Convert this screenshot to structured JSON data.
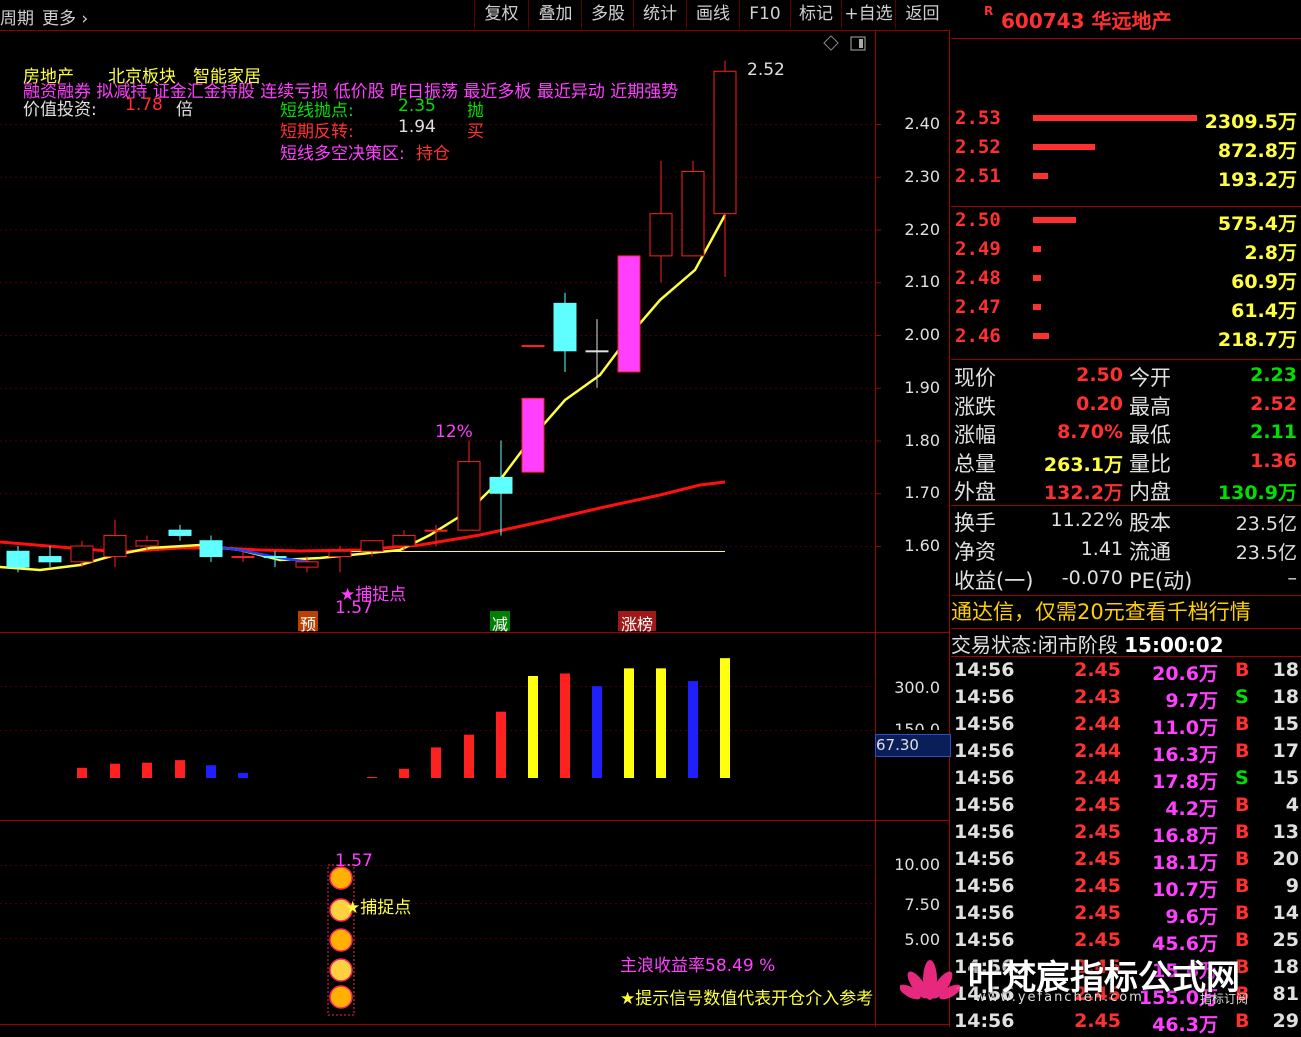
{
  "toolbar": {
    "period": "周期",
    "more": "更多",
    "buttons": [
      "复权",
      "叠加",
      "多股",
      "统计",
      "画线",
      "F10",
      "标记",
      "+自选",
      "返回"
    ]
  },
  "stock": {
    "mark": "R",
    "code_name": "600743 华远地产"
  },
  "main_chart": {
    "tags": [
      "房地产",
      "北京板块",
      "智能家居"
    ],
    "concepts": "融资融券 拟减持 证金汇金持股 连续亏损 低价股 昨日振荡 最近多板 最近异动 近期强势",
    "value_label": "价值投资:",
    "value_num": "1.78",
    "value_unit": "倍",
    "short_sell_label": "短线抛点:",
    "short_sell_val": "2.35",
    "short_sell_action": "抛",
    "short_rev_label": "短期反转:",
    "short_rev_val": "1.94",
    "short_rev_action": "买",
    "zone_label": "短线多空决策区:",
    "zone_val": "持仓",
    "high_label": "2.52",
    "pct_label": "12%",
    "catch_label": "★捕捉点",
    "catch_val": "1.57",
    "markers": [
      "预",
      "减",
      "涨榜"
    ],
    "y_axis": [
      "2.40",
      "2.30",
      "2.20",
      "2.10",
      "2.00",
      "1.90",
      "1.80",
      "1.70",
      "1.60"
    ]
  },
  "chart_data": {
    "type": "candlestick",
    "y_range": [
      1.53,
      2.55
    ],
    "candles": [
      {
        "o": 1.56,
        "h": 1.6,
        "l": 1.55,
        "c": 1.59,
        "col": "cyan"
      },
      {
        "o": 1.58,
        "h": 1.6,
        "l": 1.56,
        "c": 1.57,
        "col": "cyan"
      },
      {
        "o": 1.57,
        "h": 1.61,
        "l": 1.56,
        "c": 1.6,
        "col": "red"
      },
      {
        "o": 1.58,
        "h": 1.65,
        "l": 1.56,
        "c": 1.62,
        "col": "red"
      },
      {
        "o": 1.6,
        "h": 1.62,
        "l": 1.59,
        "c": 1.61,
        "col": "red"
      },
      {
        "o": 1.62,
        "h": 1.64,
        "l": 1.61,
        "c": 1.63,
        "col": "cyan"
      },
      {
        "o": 1.61,
        "h": 1.62,
        "l": 1.57,
        "c": 1.58,
        "col": "cyan"
      },
      {
        "o": 1.58,
        "h": 1.59,
        "l": 1.57,
        "c": 1.58,
        "col": "red"
      },
      {
        "o": 1.58,
        "h": 1.59,
        "l": 1.56,
        "c": 1.58,
        "col": "cyan"
      },
      {
        "o": 1.56,
        "h": 1.58,
        "l": 1.55,
        "c": 1.57,
        "col": "red"
      },
      {
        "o": 1.58,
        "h": 1.6,
        "l": 1.55,
        "c": 1.59,
        "col": "red"
      },
      {
        "o": 1.59,
        "h": 1.61,
        "l": 1.58,
        "c": 1.61,
        "col": "red"
      },
      {
        "o": 1.6,
        "h": 1.63,
        "l": 1.59,
        "c": 1.62,
        "col": "red"
      },
      {
        "o": 1.63,
        "h": 1.64,
        "l": 1.6,
        "c": 1.63,
        "col": "red"
      },
      {
        "o": 1.63,
        "h": 1.8,
        "l": 1.63,
        "c": 1.76,
        "col": "red"
      },
      {
        "o": 1.73,
        "h": 1.8,
        "l": 1.62,
        "c": 1.7,
        "col": "cyan"
      },
      {
        "o": 1.74,
        "h": 1.88,
        "l": 1.74,
        "c": 1.88,
        "col": "magenta"
      },
      {
        "o": 1.98,
        "h": 1.98,
        "l": 1.98,
        "c": 1.98,
        "col": "magenta"
      },
      {
        "o": 2.06,
        "h": 2.08,
        "l": 1.93,
        "c": 1.97,
        "col": "cyan"
      },
      {
        "o": 1.97,
        "h": 2.03,
        "l": 1.9,
        "c": 1.97,
        "col": "white"
      },
      {
        "o": 1.93,
        "h": 2.15,
        "l": 1.93,
        "c": 2.15,
        "col": "magenta"
      },
      {
        "o": 2.15,
        "h": 2.33,
        "l": 2.1,
        "c": 2.23,
        "col": "red"
      },
      {
        "o": 2.15,
        "h": 2.33,
        "l": 2.15,
        "c": 2.31,
        "col": "red"
      },
      {
        "o": 2.23,
        "h": 2.52,
        "l": 2.11,
        "c": 2.5,
        "col": "red"
      }
    ]
  },
  "vol_panel": {
    "y_axis": [
      "300.0",
      "150.0"
    ],
    "cursor_val": "67.30",
    "bars": [
      {
        "v": 20,
        "c": "red"
      },
      {
        "v": 28,
        "c": "red"
      },
      {
        "v": 30,
        "c": "red"
      },
      {
        "v": 35,
        "c": "red"
      },
      {
        "v": 25,
        "c": "blue"
      },
      {
        "v": 10,
        "c": "blue"
      },
      {
        "v": 0,
        "c": "red"
      },
      {
        "v": 0,
        "c": "red"
      },
      {
        "v": 0,
        "c": "red"
      },
      {
        "v": 2,
        "c": "red"
      },
      {
        "v": 18,
        "c": "red"
      },
      {
        "v": 60,
        "c": "red"
      },
      {
        "v": 85,
        "c": "red"
      },
      {
        "v": 130,
        "c": "red"
      },
      {
        "v": 200,
        "c": "yellow"
      },
      {
        "v": 205,
        "c": "red"
      },
      {
        "v": 180,
        "c": "blue"
      },
      {
        "v": 215,
        "c": "yellow"
      },
      {
        "v": 215,
        "c": "yellow"
      },
      {
        "v": 190,
        "c": "blue"
      },
      {
        "v": 235,
        "c": "yellow"
      }
    ]
  },
  "sub_panel": {
    "y_axis": [
      "10.00",
      "7.50",
      "5.00"
    ],
    "top_val": "1.57",
    "catch_label": "★捕捉点",
    "yield_label": "主浪收益率",
    "yield_val": "58.49 %",
    "hint": "★提示信号数值代表开仓介入参考"
  },
  "order_book": {
    "asks": [
      {
        "p": "2.53",
        "v": "2309.5万",
        "w": 100
      },
      {
        "p": "2.52",
        "v": "872.8万",
        "w": 38
      },
      {
        "p": "2.51",
        "v": "193.2万",
        "w": 9
      }
    ],
    "bids": [
      {
        "p": "2.50",
        "v": "575.4万",
        "w": 26
      },
      {
        "p": "2.49",
        "v": "2.8万",
        "w": 1
      },
      {
        "p": "2.48",
        "v": "60.9万",
        "w": 2
      },
      {
        "p": "2.47",
        "v": "61.4万",
        "w": 2
      },
      {
        "p": "2.46",
        "v": "218.7万",
        "w": 10
      }
    ]
  },
  "quote": {
    "rows": [
      {
        "l1": "现价",
        "v1": "2.50",
        "c1": "#ff3030",
        "l2": "今开",
        "v2": "2.23",
        "c2": "#00e000"
      },
      {
        "l1": "涨跌",
        "v1": "0.20",
        "c1": "#ff3030",
        "l2": "最高",
        "v2": "2.52",
        "c2": "#ff3030"
      },
      {
        "l1": "涨幅",
        "v1": "8.70%",
        "c1": "#ff3030",
        "l2": "最低",
        "v2": "2.11",
        "c2": "#00e000"
      },
      {
        "l1": "总量",
        "v1": "263.1万",
        "c1": "#ffff40",
        "l2": "量比",
        "v2": "1.36",
        "c2": "#ff3030"
      },
      {
        "l1": "外盘",
        "v1": "132.2万",
        "c1": "#ff3030",
        "l2": "内盘",
        "v2": "130.9万",
        "c2": "#00e000"
      }
    ],
    "rows2": [
      {
        "l1": "换手",
        "v1": "11.22%",
        "l2": "股本",
        "v2": "23.5亿"
      },
      {
        "l1": "净资",
        "v1": "1.41",
        "l2": "流通",
        "v2": "23.5亿"
      },
      {
        "l1": "收益(一)",
        "v1": "-0.070",
        "l2": "PE(动)",
        "v2": "–"
      }
    ]
  },
  "banner": "通达信，仅需20元查看千档行情",
  "trade_status": {
    "label": "交易状态:",
    "state": "闭市阶段",
    "time": "15:00:02"
  },
  "ticks": [
    {
      "t": "14:56",
      "p": "2.45",
      "v": "20.6万",
      "s": "B",
      "n": "18"
    },
    {
      "t": "14:56",
      "p": "2.43",
      "v": "9.7万",
      "s": "S",
      "n": "18"
    },
    {
      "t": "14:56",
      "p": "2.44",
      "v": "11.0万",
      "s": "B",
      "n": "15"
    },
    {
      "t": "14:56",
      "p": "2.44",
      "v": "16.3万",
      "s": "B",
      "n": "17"
    },
    {
      "t": "14:56",
      "p": "2.44",
      "v": "17.8万",
      "s": "S",
      "n": "15"
    },
    {
      "t": "14:56",
      "p": "2.45",
      "v": "4.2万",
      "s": "B",
      "n": "4"
    },
    {
      "t": "14:56",
      "p": "2.45",
      "v": "16.8万",
      "s": "B",
      "n": "13"
    },
    {
      "t": "14:56",
      "p": "2.45",
      "v": "18.1万",
      "s": "B",
      "n": "20"
    },
    {
      "t": "14:56",
      "p": "2.45",
      "v": "10.7万",
      "s": "B",
      "n": "9"
    },
    {
      "t": "14:56",
      "p": "2.45",
      "v": "9.6万",
      "s": "B",
      "n": "14"
    },
    {
      "t": "14:56",
      "p": "2.45",
      "v": "45.6万",
      "s": "B",
      "n": "25"
    },
    {
      "t": "14:56",
      "p": "2.45",
      "v": "15.6万",
      "s": "B",
      "n": "18"
    },
    {
      "t": "14:56",
      "p": "2.45",
      "v": "155.0万",
      "s": "B",
      "n": "81"
    },
    {
      "t": "14:56",
      "p": "2.45",
      "v": "46.3万",
      "s": "B",
      "n": "29"
    }
  ],
  "watermark": {
    "title": "叶梵宸指标公式网",
    "url": "www.yefanchen.com",
    "sub": "指标订阅"
  },
  "colors": {
    "up": "#ff3030",
    "down": "#00e000",
    "frame": "#a00000",
    "ma_yellow": "#ffff40",
    "ma_red": "#ff1010"
  }
}
